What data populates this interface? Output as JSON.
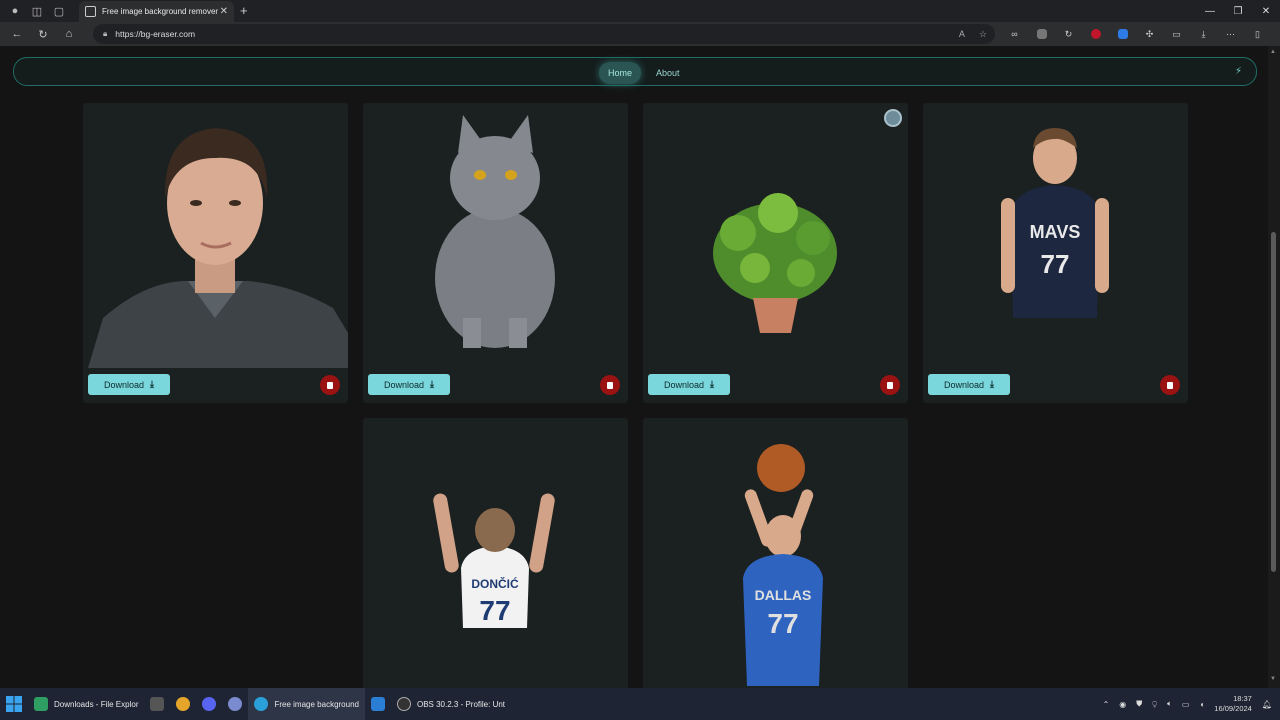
{
  "browser": {
    "tab_title": "Free image background remover",
    "url": "https://bg-eraser.com"
  },
  "site": {
    "nav": [
      {
        "label": "Home",
        "active": true
      },
      {
        "label": "About",
        "active": false
      }
    ]
  },
  "gallery": {
    "download_label": "Download",
    "items": [
      {
        "subject": "portrait-man",
        "has_controls": true
      },
      {
        "subject": "grey-cat",
        "has_controls": true
      },
      {
        "subject": "potted-plant",
        "has_controls": true,
        "loading": true
      },
      {
        "subject": "basketball-player-maus-jersey",
        "has_controls": true
      },
      {
        "subject": "basketball-player-back-doncic",
        "has_controls": false
      },
      {
        "subject": "basketball-player-shooting",
        "has_controls": false
      }
    ]
  },
  "taskbar": {
    "items": [
      {
        "label": "Downloads - File Explor",
        "icon": "file-explorer-icon",
        "color": "#2e9e63"
      },
      {
        "label": "",
        "icon": "terminal-icon",
        "color": "#555"
      },
      {
        "label": "",
        "icon": "chrome-icon",
        "color": "#e5a52a"
      },
      {
        "label": "",
        "icon": "discord-icon",
        "color": "#5865f2"
      },
      {
        "label": "",
        "icon": "app-icon",
        "color": "#7a8bd0"
      },
      {
        "label": "Free image background",
        "icon": "edge-icon",
        "color": "#2a9fd8"
      },
      {
        "label": "",
        "icon": "vscode-icon",
        "color": "#2a7fd4"
      },
      {
        "label": "OBS 30.2.3 - Profile: Unt",
        "icon": "obs-icon",
        "color": "#333"
      }
    ],
    "time": "18:37",
    "date": "16/09/2024"
  },
  "colors": {
    "accent": "#7ad7dc",
    "delete": "#9a1212",
    "card_bg": "#1b2020",
    "nav_border": "#1e6e66"
  }
}
